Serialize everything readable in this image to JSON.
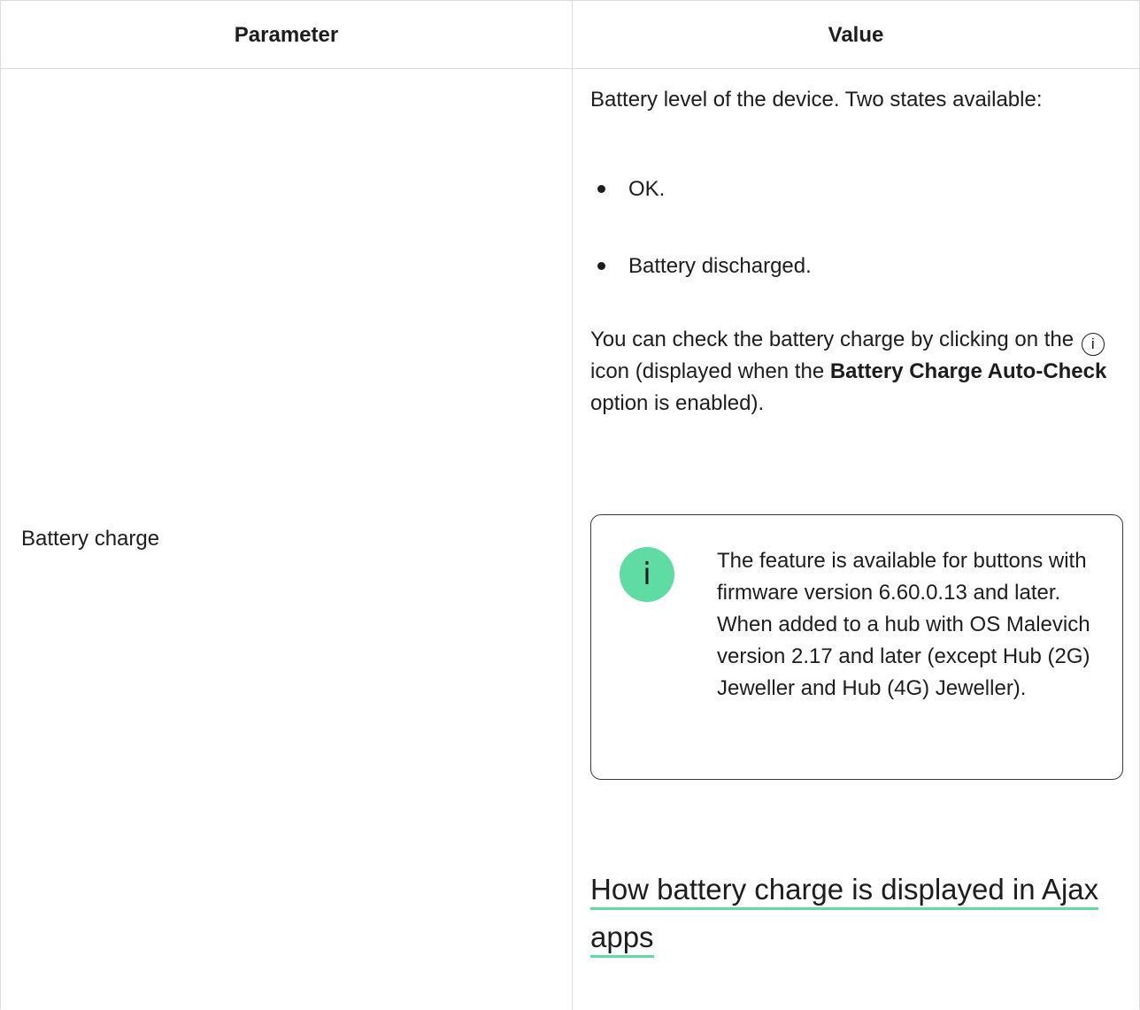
{
  "table": {
    "headers": {
      "parameter": "Parameter",
      "value": "Value"
    },
    "row": {
      "parameter": "Battery charge",
      "intro": "Battery level of the device. Two states available:",
      "states": [
        "OK.",
        "Battery discharged."
      ],
      "check_text": {
        "part1": "You can check the battery charge by clicking on the",
        "icon_glyph": "i",
        "part2": "icon (displayed when the",
        "bold1": "Battery Charge Auto-Check",
        "part3": "option is enabled)."
      },
      "notice": {
        "icon": "info-icon",
        "icon_glyph": "i",
        "text": "The feature is available for buttons with firmware version 6.60.0.13 and later. When added to a hub with OS Malevich version 2.17 and later (except Hub (2G) Jeweller and Hub (4G) Jeweller).",
        "accent_color": "#5fdba4"
      },
      "link_heading": "How battery charge is displayed in Ajax apps"
    }
  }
}
